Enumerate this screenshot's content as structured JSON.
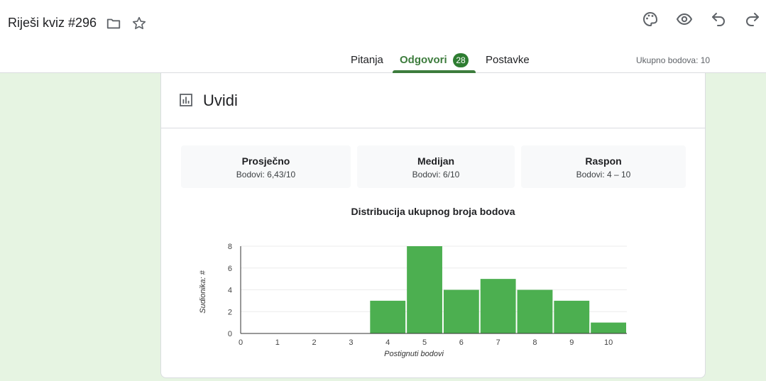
{
  "header": {
    "title": "Riješi kviz #296",
    "icons": [
      "folder-icon",
      "star-icon",
      "palette-icon",
      "eye-icon",
      "undo-icon",
      "redo-icon"
    ]
  },
  "tabs": [
    {
      "label": "Pitanja"
    },
    {
      "label": "Odgovori",
      "badge": "28"
    },
    {
      "label": "Postavke"
    }
  ],
  "total_points": "Ukupno bodova: 10",
  "insights": {
    "title": "Uvidi",
    "icon": "bar-chart-icon",
    "stats": [
      {
        "label": "Prosječno",
        "value": "Bodovi: 6,43/10"
      },
      {
        "label": "Medijan",
        "value": "Bodovi: 6/10"
      },
      {
        "label": "Raspon",
        "value": "Bodovi: 4 – 10"
      }
    ]
  },
  "colors": {
    "accent": "#3d7c3d",
    "bar": "#4caf50",
    "background": "#e6f4e2"
  },
  "chart_data": {
    "type": "bar",
    "title": "Distribucija ukupnog broja bodova",
    "xlabel": "Postignuti bodovi",
    "ylabel": "Sudionika: #",
    "categories": [
      "0",
      "1",
      "2",
      "3",
      "4",
      "5",
      "6",
      "7",
      "8",
      "9",
      "10"
    ],
    "values": [
      0,
      0,
      0,
      0,
      3,
      8,
      4,
      5,
      4,
      3,
      1
    ],
    "yticks": [
      "0",
      "2",
      "4",
      "6",
      "8"
    ],
    "ylim": [
      0,
      8
    ],
    "grid": true
  }
}
